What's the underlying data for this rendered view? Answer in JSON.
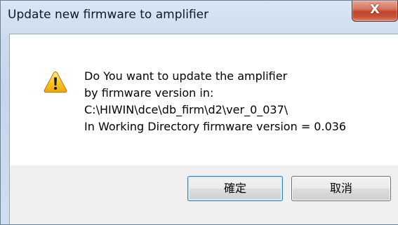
{
  "window": {
    "title": "Update new firmware to amplifier",
    "close_label": "X"
  },
  "message": {
    "icon": "warning-icon",
    "lines": [
      "Do You want to update the amplifier",
      "by firmware version in:",
      "C:\\HIWIN\\dce\\db_firm\\d2\\ver_0_037\\",
      "In Working Directory firmware version = 0.036"
    ]
  },
  "buttons": {
    "ok_label": "確定",
    "cancel_label": "取消"
  },
  "colors": {
    "title_bar": "#cbdcee",
    "close_button": "#c9533a",
    "warning_fill": "#f7c323",
    "ok_focus_border": "#3c7fb1"
  }
}
